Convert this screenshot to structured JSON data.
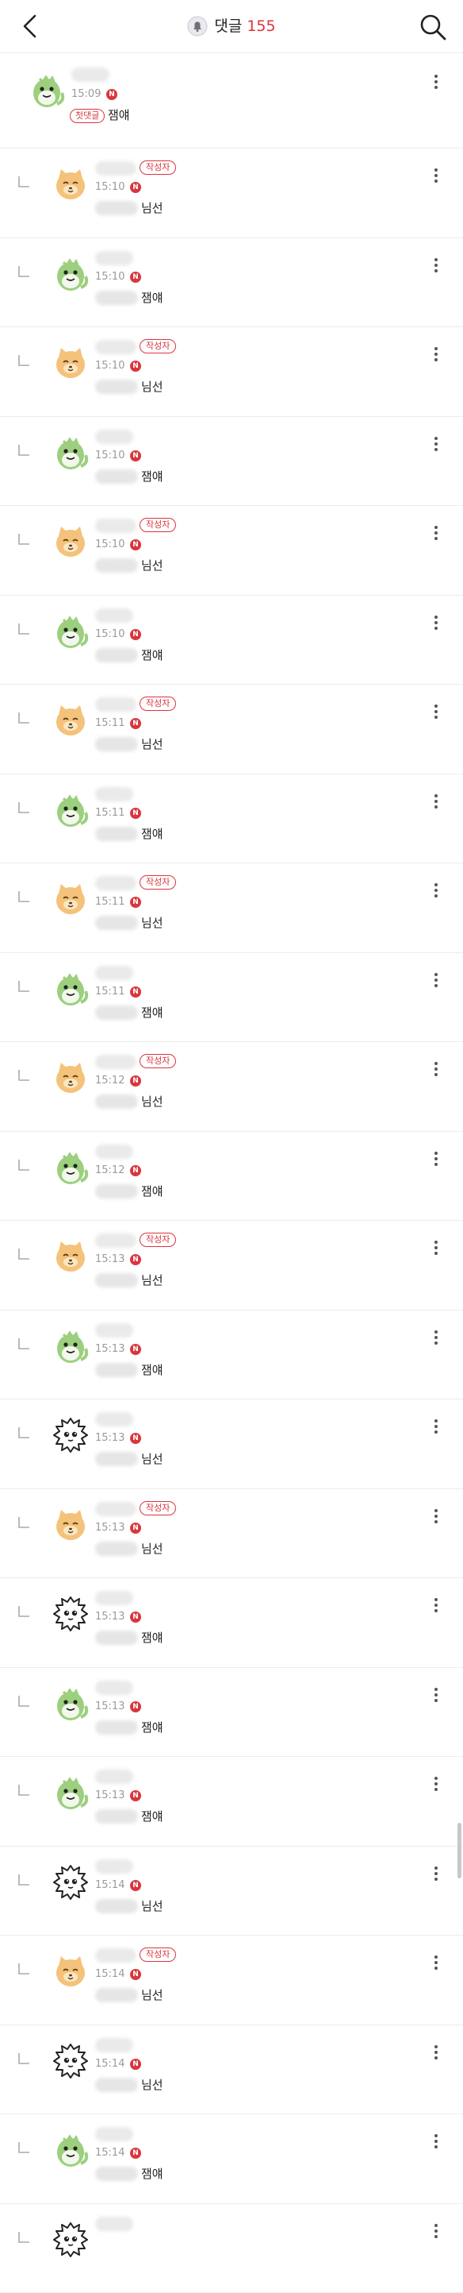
{
  "header": {
    "title": "댓글",
    "count": "155"
  },
  "badges": {
    "author": "작성자",
    "first": "첫댓글",
    "new": "N"
  },
  "comments": [
    {
      "avatar": "dragon",
      "time": "15:09",
      "text": "잼얘",
      "author": false,
      "reply": false,
      "first": true
    },
    {
      "avatar": "cat",
      "time": "15:10",
      "text": "님선",
      "author": true,
      "reply": true
    },
    {
      "avatar": "dragon",
      "time": "15:10",
      "text": "잼얘",
      "author": false,
      "reply": true
    },
    {
      "avatar": "cat",
      "time": "15:10",
      "text": "님선",
      "author": true,
      "reply": true
    },
    {
      "avatar": "dragon",
      "time": "15:10",
      "text": "잼얘",
      "author": false,
      "reply": true
    },
    {
      "avatar": "cat",
      "time": "15:10",
      "text": "님선",
      "author": true,
      "reply": true
    },
    {
      "avatar": "dragon",
      "time": "15:10",
      "text": "잼얘",
      "author": false,
      "reply": true
    },
    {
      "avatar": "cat",
      "time": "15:11",
      "text": "님선",
      "author": true,
      "reply": true
    },
    {
      "avatar": "dragon",
      "time": "15:11",
      "text": "잼얘",
      "author": false,
      "reply": true
    },
    {
      "avatar": "cat",
      "time": "15:11",
      "text": "님선",
      "author": true,
      "reply": true
    },
    {
      "avatar": "dragon",
      "time": "15:11",
      "text": "잼얘",
      "author": false,
      "reply": true
    },
    {
      "avatar": "cat",
      "time": "15:12",
      "text": "님선",
      "author": true,
      "reply": true
    },
    {
      "avatar": "dragon",
      "time": "15:12",
      "text": "잼얘",
      "author": false,
      "reply": true
    },
    {
      "avatar": "cat",
      "time": "15:13",
      "text": "님선",
      "author": true,
      "reply": true
    },
    {
      "avatar": "dragon",
      "time": "15:13",
      "text": "잼얘",
      "author": false,
      "reply": true
    },
    {
      "avatar": "fluffy",
      "time": "15:13",
      "text": "님선",
      "author": false,
      "reply": true
    },
    {
      "avatar": "cat",
      "time": "15:13",
      "text": "님선",
      "author": true,
      "reply": true
    },
    {
      "avatar": "fluffy",
      "time": "15:13",
      "text": "잼얘",
      "author": false,
      "reply": true
    },
    {
      "avatar": "dragon",
      "time": "15:13",
      "text": "잼얘",
      "author": false,
      "reply": true
    },
    {
      "avatar": "dragon",
      "time": "15:13",
      "text": "잼얘",
      "author": false,
      "reply": true
    },
    {
      "avatar": "fluffy",
      "time": "15:14",
      "text": "님선",
      "author": false,
      "reply": true
    },
    {
      "avatar": "cat",
      "time": "15:14",
      "text": "님선",
      "author": true,
      "reply": true
    },
    {
      "avatar": "fluffy",
      "time": "15:14",
      "text": "님선",
      "author": false,
      "reply": true
    },
    {
      "avatar": "dragon",
      "time": "15:14",
      "text": "잼얘",
      "author": false,
      "reply": true
    },
    {
      "avatar": "fluffy",
      "time": "",
      "text": "",
      "author": false,
      "reply": true
    }
  ],
  "colors": {
    "accent": "#d9363e",
    "divider": "#ececec",
    "dragon": "#9ccf7e",
    "cat": "#f4c27a"
  }
}
